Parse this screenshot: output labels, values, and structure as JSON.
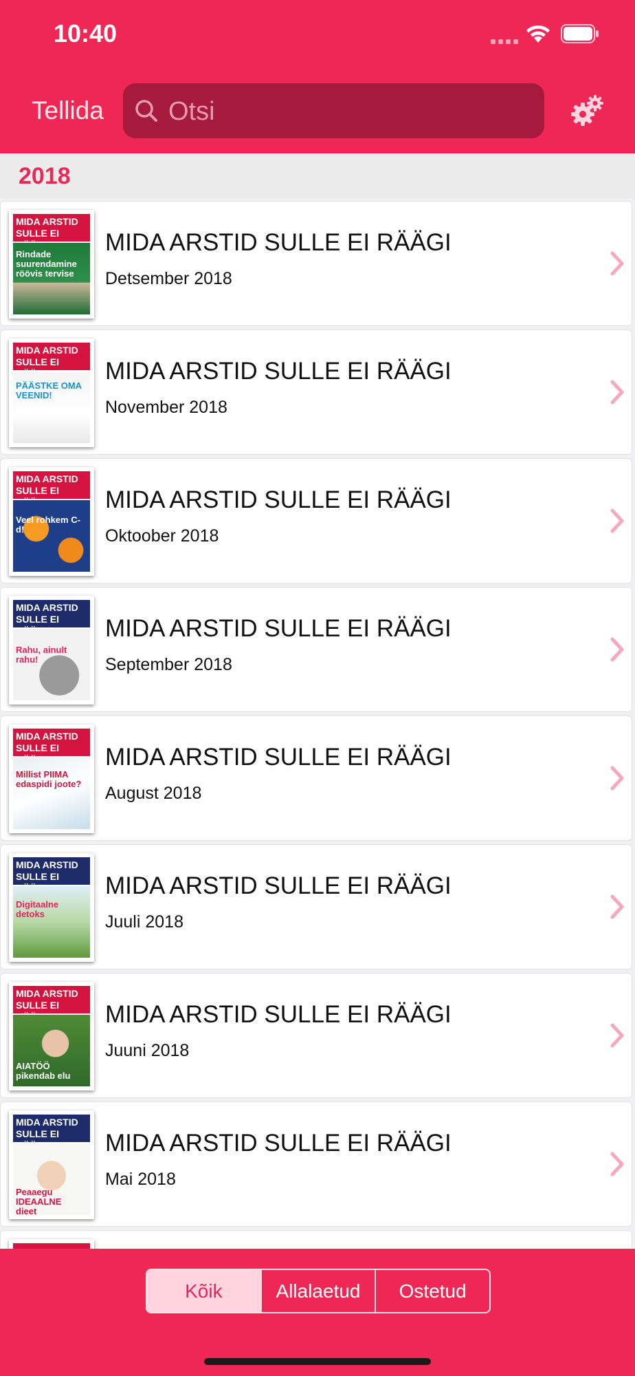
{
  "status_bar": {
    "time": "10:40"
  },
  "nav": {
    "left_label": "Tellida",
    "search_placeholder": "Otsi"
  },
  "section": {
    "title": "2018"
  },
  "issues": [
    {
      "title": "MIDA ARSTID SULLE EI RÄÄGI",
      "date": "Detsember 2018",
      "cover_tag": "Rindade suurendamine röövis tervise"
    },
    {
      "title": "MIDA ARSTID SULLE EI RÄÄGI",
      "date": "November 2018",
      "cover_tag": "PÄÄSTKE OMA VEENID!"
    },
    {
      "title": "MIDA ARSTID SULLE EI RÄÄGI",
      "date": "Oktoober 2018",
      "cover_tag": "Veel rohkem C-d!"
    },
    {
      "title": "MIDA ARSTID SULLE EI RÄÄGI",
      "date": "September 2018",
      "cover_tag": "Rahu, ainult rahu!"
    },
    {
      "title": "MIDA ARSTID SULLE EI RÄÄGI",
      "date": "August 2018",
      "cover_tag": "Millist PIIMA edaspidi joote?"
    },
    {
      "title": "MIDA ARSTID SULLE EI RÄÄGI",
      "date": "Juuli 2018",
      "cover_tag": "Digitaalne detoks"
    },
    {
      "title": "MIDA ARSTID SULLE EI RÄÄGI",
      "date": "Juuni 2018",
      "cover_tag": "AIATÖÖ pikendab elu"
    },
    {
      "title": "MIDA ARSTID SULLE EI RÄÄGI",
      "date": "Mai 2018",
      "cover_tag": "Peaaegu IDEAALNE dieet"
    }
  ],
  "cover_masthead": "MIDA ARSTID SULLE EI RÄÄGI",
  "segments": [
    "Kõik",
    "Allalaetud",
    "Ostetud"
  ],
  "colors": {
    "brand": "#ef2755",
    "search_bg": "#a51a3d",
    "chevron": "#f7a8bd"
  }
}
